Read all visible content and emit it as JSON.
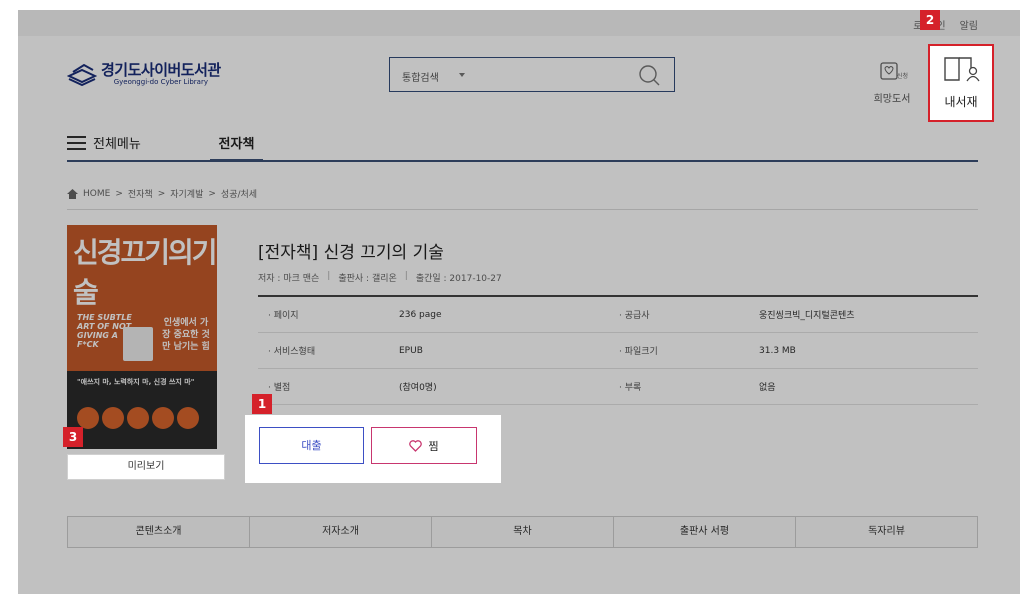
{
  "topbar": {
    "login": "로",
    "mid": "인",
    "alerts": "알림"
  },
  "header": {
    "logo_kr": "경기도사이버도서관",
    "logo_en": "Gyeonggi-do Cyber Library",
    "search_scope": "통합검색",
    "wish_badge": "신청",
    "wish_label": "희망도서",
    "mylib_label": "내서재"
  },
  "nav": {
    "menu_label": "전체메뉴",
    "tab_label": "전자책"
  },
  "breadcrumb": {
    "home": "HOME",
    "sep": ">",
    "c1": "전자책",
    "c2": "자기계발",
    "c3": "성공/처세"
  },
  "book": {
    "title": "[전자책] 신경 끄기의 기술",
    "author": "저자 : 마크 맨슨",
    "publisher": "출판사 : 갤리온",
    "pubdate": "출간일 : 2017-10-27",
    "meta_sep": "|",
    "cover_title": "신경끄기의기술",
    "cover_en": "THE SUBTLE ART OF NOT GIVING A F*CK",
    "cover_sub": "인생에서 가장 중요한 것만 남기는 힘",
    "cover_quote": "\"애쓰지 마, 노력하지 마, 신경 쓰지 마\""
  },
  "info": {
    "r1": {
      "k1": "· 페이지",
      "v1": "236 page",
      "k2": "· 공급사",
      "v2": "웅진씽크빅_디지털콘텐츠"
    },
    "r2": {
      "k1": "· 서비스형태",
      "v1": "EPUB",
      "k2": "· 파일크기",
      "v2": "31.3 MB"
    },
    "r3": {
      "k1": "· 별점",
      "v1": "(참여0명)",
      "k2": "· 부록",
      "v2": "없음"
    }
  },
  "actions": {
    "loan": "대출",
    "wish": "찜"
  },
  "preview": "미리보기",
  "tabs": [
    "콘텐츠소개",
    "저자소개",
    "목차",
    "출판사 서평",
    "독자리뷰"
  ],
  "badges": {
    "b1": "1",
    "b2": "2",
    "b3": "3"
  },
  "colors": {
    "brand": "#1a2e7a",
    "accent_blue": "#3d4fc4",
    "accent_pink": "#c8366f",
    "highlight": "#d5212a"
  }
}
